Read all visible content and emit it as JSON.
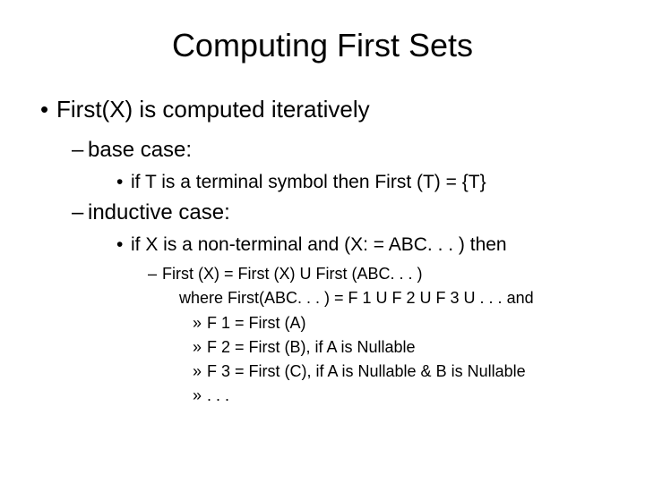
{
  "title": "Computing First Sets",
  "main_point": "First(X) is computed iteratively",
  "base_case": {
    "label": "base case:",
    "rule": "if T is a terminal symbol then First (T) = {T}"
  },
  "inductive_case": {
    "label": "inductive case:",
    "rule": "if X is a non-terminal and (X: = ABC. . . ) then",
    "sub1": "First (X) = First (X) U First (ABC. . . )",
    "sub1_where": "where First(ABC. . . ) = F 1 U F 2 U F 3 U . . . and",
    "f1": "F 1 = First (A)",
    "f2": "F 2 = First (B), if A is Nullable",
    "f3": "F 3 = First (C), if A is Nullable & B is Nullable",
    "ellipsis": ". . ."
  }
}
